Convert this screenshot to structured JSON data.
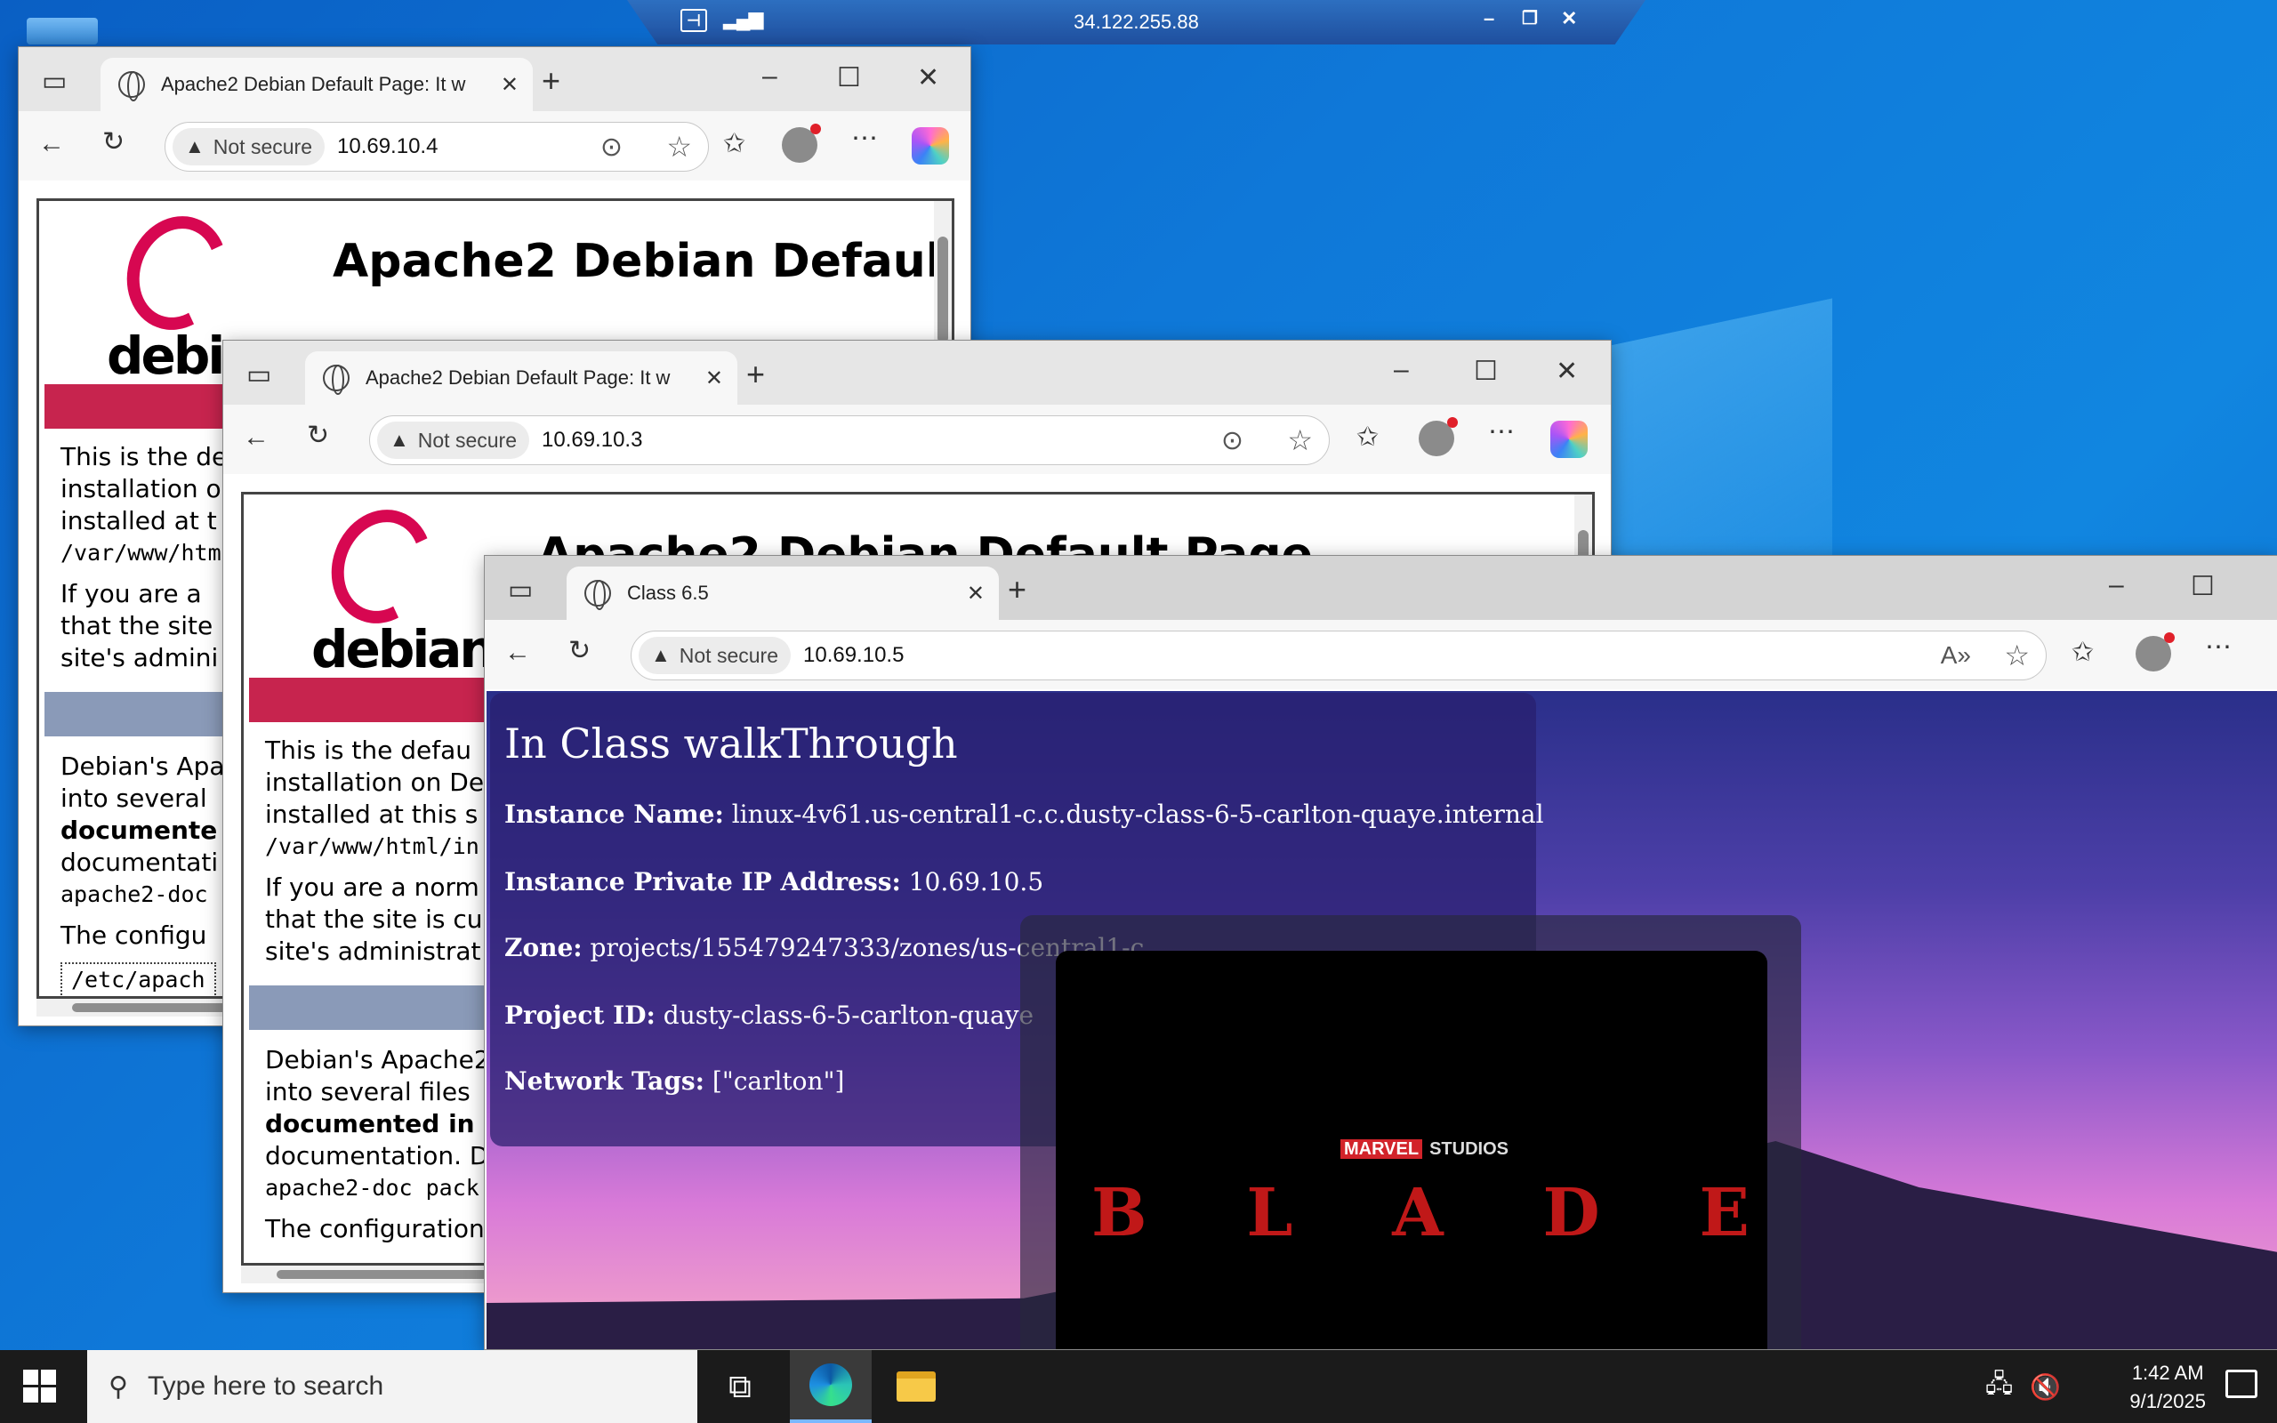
{
  "rdp": {
    "host": "34.122.255.88",
    "pin_icon": "pin-icon",
    "signal_icon": "signal-icon"
  },
  "window1": {
    "tab_title": "Apache2 Debian Default Page: It w",
    "security": "Not secure",
    "url": "10.69.10.4",
    "heading": "Apache2 Debian Defaul",
    "debian_word": "debian",
    "lines": [
      "This is the de",
      "installation o",
      "installed at t",
      "/var/www/htm",
      "If you are a",
      "that the site",
      "site's admini",
      "Debian's Apa",
      "into several",
      "documente",
      "documentati",
      "apache2-doc",
      "The configu",
      "/etc/apach"
    ]
  },
  "window2": {
    "tab_title": "Apache2 Debian Default Page: It w",
    "security": "Not secure",
    "url": "10.69.10.3",
    "heading": "Apache2 Debian Default Page",
    "debian_word": "debian",
    "lines": [
      "This is the defau",
      "installation on De",
      "installed at this s",
      "/var/www/html/in",
      "If you are a norm",
      "that the site is cu",
      "site's administrat",
      "Debian's Apache2",
      "into several files",
      "documented in",
      "documentation. D",
      "apache2-doc pack",
      "The configuration"
    ]
  },
  "window3": {
    "tab_title": "Class 6.5",
    "security": "Not secure",
    "url": "10.69.10.5",
    "page": {
      "title": "In Class walkThrough",
      "rows": [
        {
          "label": "Instance Name:",
          "value": "linux-4v61.us-central1-c.c.dusty-class-6-5-carlton-quaye.internal"
        },
        {
          "label": "Instance Private IP Address:",
          "value": "10.69.10.5"
        },
        {
          "label": "Zone:",
          "value": "projects/155479247333/zones/us-central1-c"
        },
        {
          "label": "Project ID:",
          "value": "dusty-class-6-5-carlton-quaye"
        },
        {
          "label": "Network Tags:",
          "value": "[\"carlton\"]"
        }
      ],
      "video": {
        "studio_brand": "MARVEL",
        "studio_word": "STUDIOS",
        "letters": [
          "B",
          "L",
          "A",
          "D",
          "E"
        ]
      }
    }
  },
  "taskbar": {
    "search_placeholder": "Type here to search",
    "time": "1:42 AM",
    "date": "9/1/2025"
  }
}
